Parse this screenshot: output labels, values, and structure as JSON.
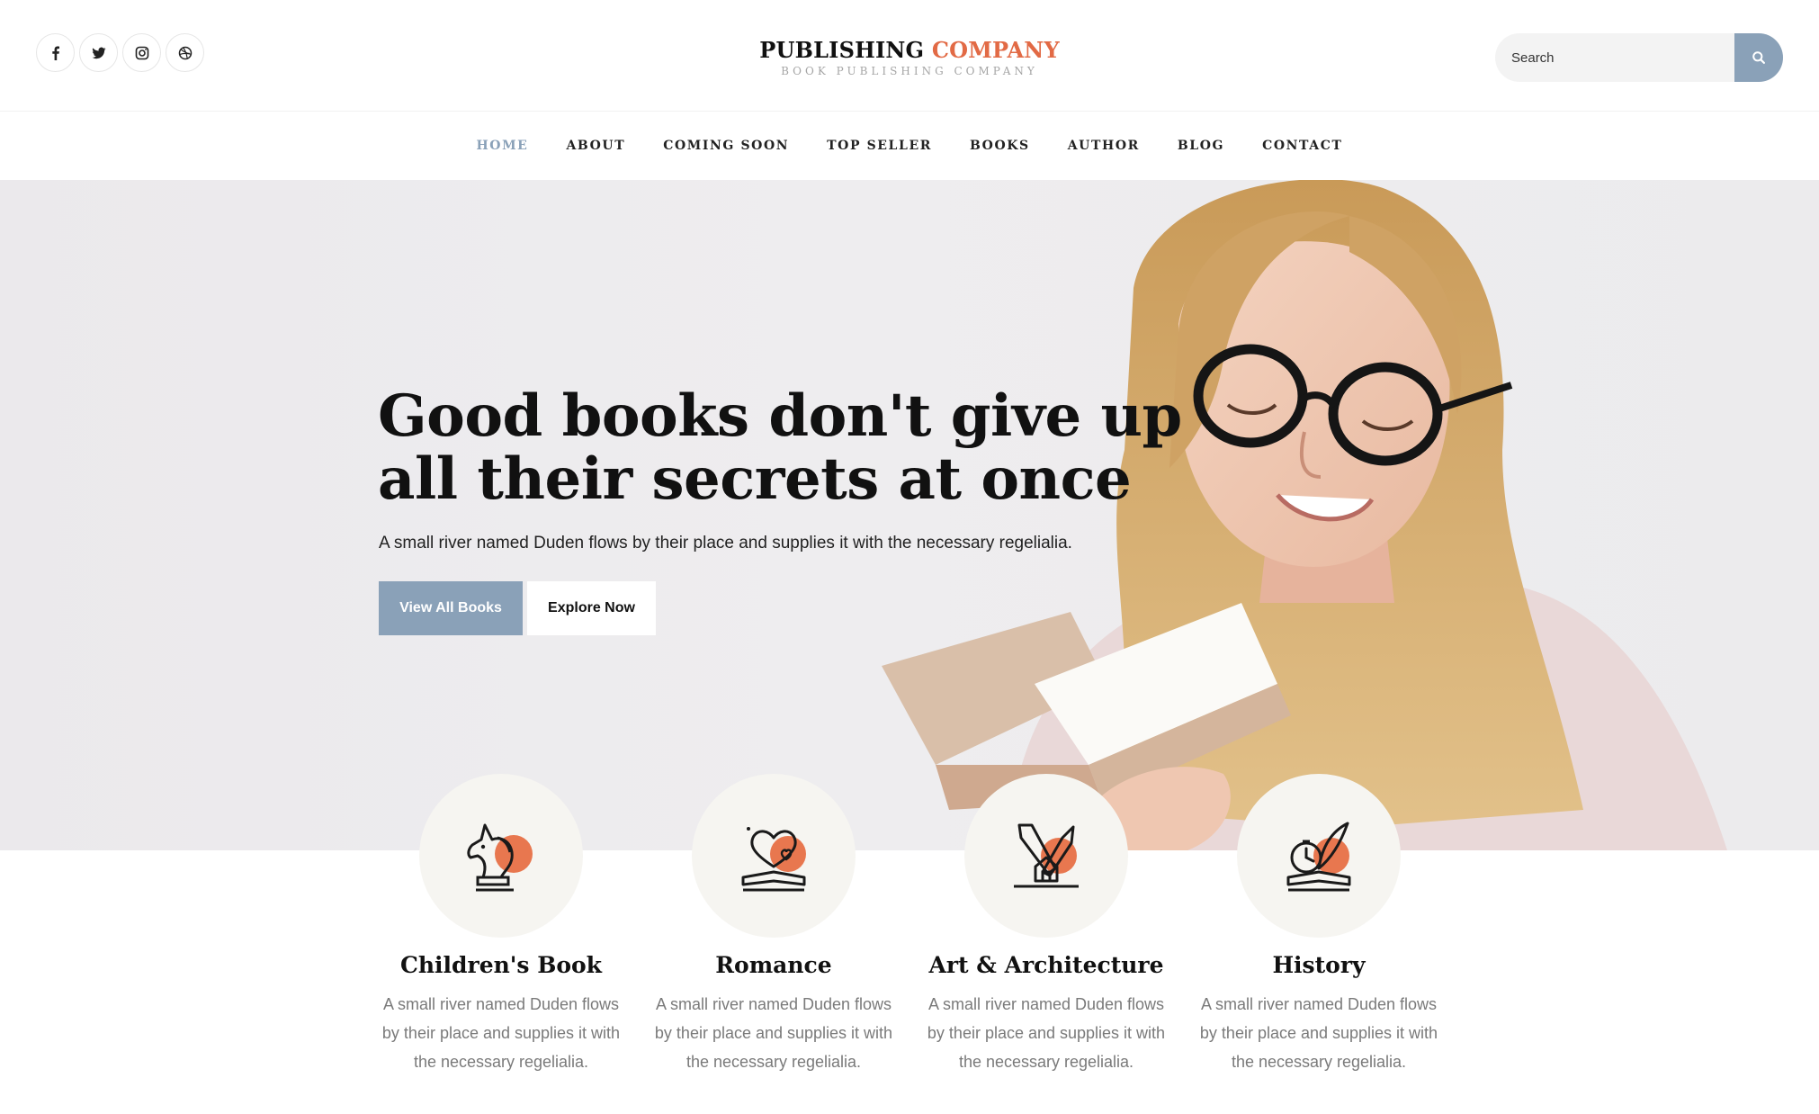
{
  "header": {
    "social": [
      {
        "icon": "facebook-icon"
      },
      {
        "icon": "twitter-icon"
      },
      {
        "icon": "instagram-icon"
      },
      {
        "icon": "dribbble-icon"
      }
    ],
    "logo": {
      "main": "PUBLISHING",
      "accent": "COMPANY",
      "tagline": "BOOK PUBLISHING COMPANY"
    },
    "search": {
      "placeholder": "Search",
      "icon": "search-icon"
    }
  },
  "nav": {
    "items": [
      "HOME",
      "ABOUT",
      "COMING SOON",
      "TOP SELLER",
      "BOOKS",
      "AUTHOR",
      "BLOG",
      "CONTACT"
    ],
    "active": "HOME"
  },
  "hero": {
    "headline_line1": "Good books don't give up",
    "headline_line2": "all their secrets at once",
    "subtext": "A small river named Duden flows by their place and supplies it with the necessary regelialia.",
    "primary_button": "View All Books",
    "secondary_button": "Explore Now"
  },
  "categories": [
    {
      "title": "Children's Book",
      "icon": "unicorn-icon",
      "description": "A small river named Duden flows by their place and supplies it with the necessary regelialia."
    },
    {
      "title": "Romance",
      "icon": "heart-book-icon",
      "description": "A small river named Duden flows by their place and supplies it with the necessary regelialia."
    },
    {
      "title": "Art & Architecture",
      "icon": "architecture-tools-icon",
      "description": "A small river named Duden flows by their place and supplies it with the necessary regelialia."
    },
    {
      "title": "History",
      "icon": "quill-book-icon",
      "description": "A small river named Duden flows by their place and supplies it with the necessary regelialia."
    }
  ],
  "colors": {
    "accent": "#e26a45",
    "primary": "#8aa1b8",
    "text": "#111111",
    "muted": "#7a7a7a"
  }
}
